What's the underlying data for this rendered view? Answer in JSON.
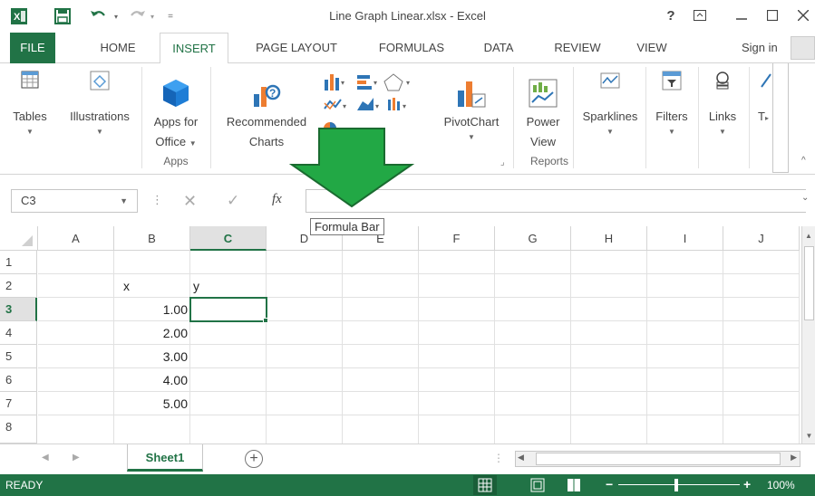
{
  "window": {
    "title": "Line Graph Linear.xlsx - Excel",
    "help_label": "?",
    "qat": [
      "excel-logo",
      "save",
      "undo",
      "redo",
      "customize"
    ]
  },
  "tabs": [
    "FILE",
    "HOME",
    "INSERT",
    "PAGE LAYOUT",
    "FORMULAS",
    "DATA",
    "REVIEW",
    "VIEW"
  ],
  "signin": "Sign in",
  "ribbon": {
    "tables": "Tables",
    "illustrations": "Illustrations",
    "apps_for_office_1": "Apps for",
    "apps_for_office_2": "Office",
    "recommended_charts_1": "Recommended",
    "recommended_charts_2": "Charts",
    "pivotchart": "PivotChart",
    "power_view_1": "Power",
    "power_view_2": "View",
    "sparklines": "Sparklines",
    "filters": "Filters",
    "links": "Links",
    "text_partial": "T",
    "group_apps": "Apps",
    "group_reports": "Reports"
  },
  "formula_bar": {
    "name_box": "C3",
    "fx_label": "fx",
    "value": "",
    "tooltip": "Formula Bar"
  },
  "grid": {
    "columns": [
      "A",
      "B",
      "C",
      "D",
      "E",
      "F",
      "G",
      "H",
      "I",
      "J"
    ],
    "rows": [
      "1",
      "2",
      "3",
      "4",
      "5",
      "6",
      "7",
      "8"
    ],
    "selected_cell": "C3",
    "cells": {
      "B2": "x",
      "C2": "y",
      "B3": "1.00",
      "B4": "2.00",
      "B5": "3.00",
      "B6": "4.00",
      "B7": "5.00"
    }
  },
  "sheets": [
    "Sheet1"
  ],
  "status": {
    "ready": "READY",
    "zoom": "100%"
  },
  "colors": {
    "excel_green": "#217346",
    "arrow_green": "#22a845"
  }
}
